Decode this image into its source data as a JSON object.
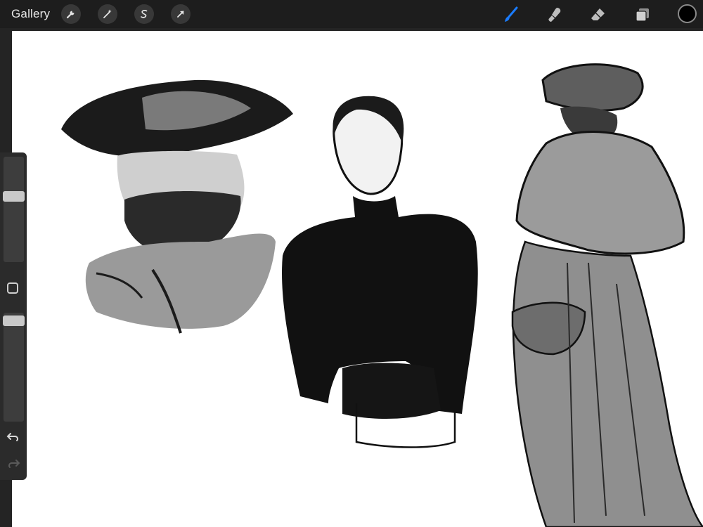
{
  "topbar": {
    "gallery_label": "Gallery",
    "left_tools": [
      {
        "name": "wrench-icon",
        "meaning": "actions"
      },
      {
        "name": "magic-wand-icon",
        "meaning": "adjustments"
      },
      {
        "name": "selection-s-icon",
        "meaning": "selection"
      },
      {
        "name": "arrow-cursor-icon",
        "meaning": "transform"
      }
    ],
    "right_tools": [
      {
        "name": "brush-icon",
        "active": true
      },
      {
        "name": "smudge-icon",
        "active": false
      },
      {
        "name": "eraser-icon",
        "active": false
      },
      {
        "name": "layers-icon",
        "active": false
      }
    ],
    "current_color": "#000000",
    "active_color": "#1a7cff"
  },
  "sidebar": {
    "brush_size_level": 0.64,
    "opacity_level": 0.97
  }
}
